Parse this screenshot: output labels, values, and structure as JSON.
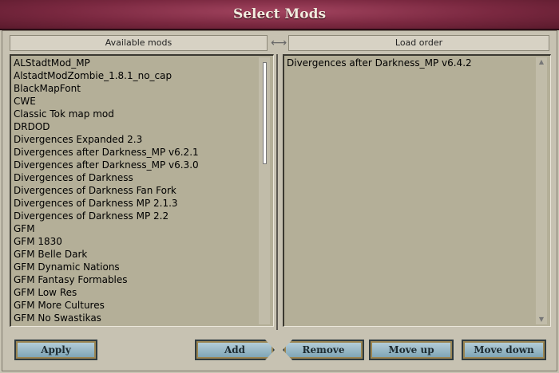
{
  "window": {
    "title": "Select Mods"
  },
  "headers": {
    "available": "Available mods",
    "load_order": "Load order",
    "swap_arrow": "⟷"
  },
  "available_mods": [
    "ALStadtMod_MP",
    "AlstadtModZombie_1.8.1_no_cap",
    "BlackMapFont",
    "CWE",
    "Classic Tok map mod",
    "DRDOD",
    "Divergences Expanded 2.3",
    "Divergences after Darkness_MP v6.2.1",
    "Divergences after Darkness_MP v6.3.0",
    "Divergences of Darkness",
    "Divergences of Darkness Fan Fork",
    "Divergences of Darkness MP 2.1.3",
    "Divergences of Darkness MP 2.2",
    "GFM",
    "GFM 1830",
    "GFM Belle Dark",
    "GFM Dynamic Nations",
    "GFM Fantasy Formables",
    "GFM Low Res",
    "GFM More Cultures",
    "GFM No Swastikas"
  ],
  "load_order": [
    "Divergences after Darkness_MP v6.4.2"
  ],
  "scroll": {
    "up": "▲",
    "down": "▼"
  },
  "buttons": {
    "apply": "Apply",
    "add": "Add",
    "remove": "Remove",
    "move_up": "Move up",
    "move_down": "Move down"
  }
}
